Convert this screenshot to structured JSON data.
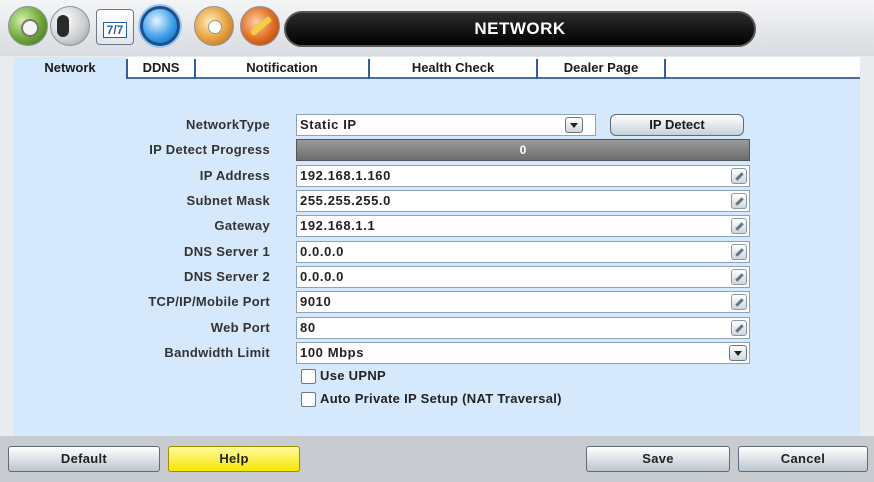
{
  "header": {
    "title": "NETWORK",
    "calendar_text": "7/7",
    "icons": [
      "setup-gear-icon",
      "disk-icon",
      "calendar-icon",
      "network-icon",
      "record-icon",
      "tools-icon"
    ]
  },
  "tabs": [
    {
      "label": "Network",
      "active": true
    },
    {
      "label": "DDNS",
      "active": false
    },
    {
      "label": "Notification",
      "active": false
    },
    {
      "label": "Health Check",
      "active": false
    },
    {
      "label": "Dealer Page",
      "active": false
    }
  ],
  "form": {
    "network_type": {
      "label": "NetworkType",
      "value": "Static IP"
    },
    "ip_detect_button": "IP Detect",
    "ip_detect_progress": {
      "label": "IP Detect Progress",
      "value": "0",
      "progress": 0
    },
    "ip_address": {
      "label": "IP Address",
      "value": "192.168.1.160"
    },
    "subnet_mask": {
      "label": "Subnet Mask",
      "value": "255.255.255.0"
    },
    "gateway": {
      "label": "Gateway",
      "value": "192.168.1.1"
    },
    "dns_server_1": {
      "label": "DNS Server 1",
      "value": "0.0.0.0"
    },
    "dns_server_2": {
      "label": "DNS Server 2",
      "value": "0.0.0.0"
    },
    "tcp_port": {
      "label": "TCP/IP/Mobile Port",
      "value": "9010"
    },
    "web_port": {
      "label": "Web Port",
      "value": "80"
    },
    "bandwidth_limit": {
      "label": "Bandwidth Limit",
      "value": "100 Mbps"
    },
    "use_upnp": {
      "label": "Use UPNP",
      "checked": false
    },
    "auto_private_ip": {
      "label": "Auto Private IP Setup (NAT Traversal)",
      "checked": false
    }
  },
  "footer": {
    "default_label": "Default",
    "help_label": "Help",
    "save_label": "Save",
    "cancel_label": "Cancel"
  },
  "colors": {
    "panel_bg": "#d6e8fb",
    "help_button": "#f6e600",
    "title_bar": "#000000"
  }
}
